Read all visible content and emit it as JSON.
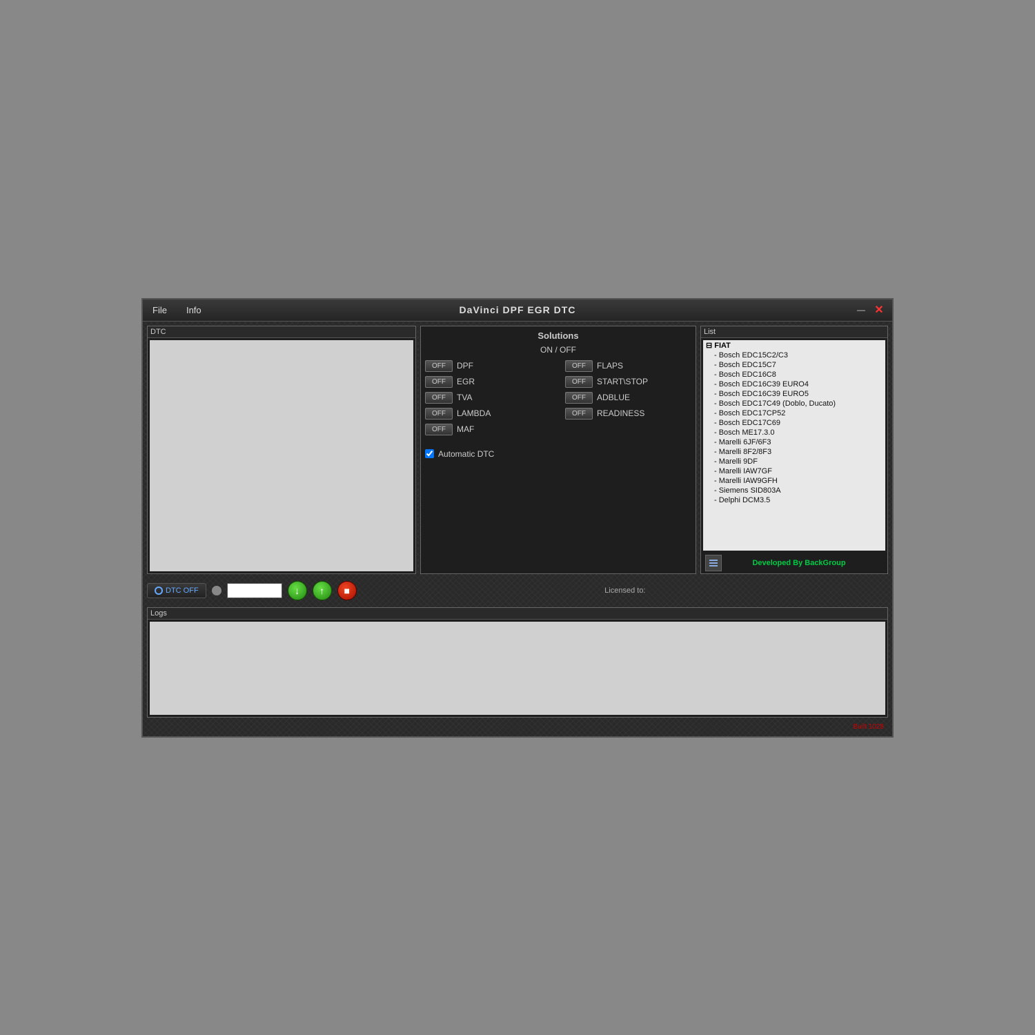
{
  "window": {
    "title": "DaVinci DPF EGR DTC",
    "minimize_btn": "—",
    "close_btn": "✕"
  },
  "menu": {
    "file_label": "File",
    "info_label": "Info"
  },
  "dtc_panel": {
    "label": "DTC"
  },
  "solutions_panel": {
    "label": "Solutions",
    "on_off_header": "ON  /  OFF",
    "toggles_left": [
      {
        "id": "dpf",
        "label": "DPF",
        "state": "OFF"
      },
      {
        "id": "egr",
        "label": "EGR",
        "state": "OFF"
      },
      {
        "id": "tva",
        "label": "TVA",
        "state": "OFF"
      },
      {
        "id": "lambda",
        "label": "LAMBDA",
        "state": "OFF"
      },
      {
        "id": "maf",
        "label": "MAF",
        "state": "OFF"
      }
    ],
    "toggles_right": [
      {
        "id": "flaps",
        "label": "FLAPS",
        "state": "OFF"
      },
      {
        "id": "startstop",
        "label": "START\\STOP",
        "state": "OFF"
      },
      {
        "id": "adblue",
        "label": "ADBLUE",
        "state": "OFF"
      },
      {
        "id": "readiness",
        "label": "READINESS",
        "state": "OFF"
      }
    ],
    "auto_dtc_label": "Automatic DTC",
    "auto_dtc_checked": true
  },
  "list_panel": {
    "label": "List",
    "tree": [
      {
        "group": "FIAT",
        "children": [
          "Bosch EDC15C2/C3",
          "Bosch EDC15C7",
          "Bosch EDC16C8",
          "Bosch EDC16C39 EURO4",
          "Bosch EDC16C39 EURO5",
          "Bosch EDC17C49  (Doblo, Ducato)",
          "Bosch EDC17CP52",
          "Bosch EDC17C69",
          "Bosch ME17.3.0",
          "Marelli 6JF/6F3",
          "Marelli 8F2/8F3",
          "Marelli 9DF",
          "Marelli IAW7GF",
          "Marelli IAW9GFH",
          "Siemens SID803A",
          "Delphi DCM3.5"
        ]
      }
    ],
    "developed_by": "Developed By BackGroup"
  },
  "controls": {
    "dtc_off_label": "DTC OFF",
    "licensed_to_label": "Licensed to:",
    "download_arrow": "↓",
    "upload_arrow": "↑"
  },
  "logs_panel": {
    "label": "Logs"
  },
  "build_info": "Built 1028"
}
